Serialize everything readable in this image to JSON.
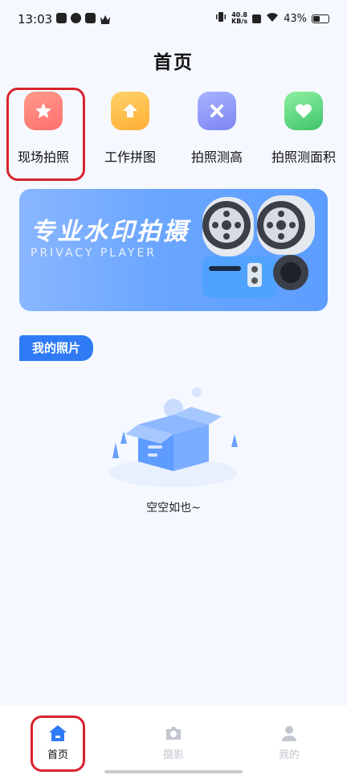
{
  "status_bar": {
    "time": "13:03",
    "net_speed_value": "40.8",
    "net_speed_unit": "KB/s",
    "battery_percent": "43%"
  },
  "header": {
    "title": "首页"
  },
  "quick_entries": [
    {
      "label": "现场拍照",
      "icon": "star-icon"
    },
    {
      "label": "工作拼图",
      "icon": "upload-icon"
    },
    {
      "label": "拍照测高",
      "icon": "measure-icon"
    },
    {
      "label": "拍照测面积",
      "icon": "heart-icon"
    }
  ],
  "banner": {
    "title": "专业水印拍摄",
    "subtitle": "PRIVACY PLAYER"
  },
  "section": {
    "title": "我的照片"
  },
  "empty_state": {
    "text": "空空如也~"
  },
  "tab_bar": {
    "tabs": [
      {
        "label": "首页",
        "active": true
      },
      {
        "label": "摄影",
        "active": false
      },
      {
        "label": "我的",
        "active": false
      }
    ]
  },
  "colors": {
    "accent": "#2f7bf5",
    "highlight": "#d9232e",
    "background": "#f5f9ff"
  }
}
